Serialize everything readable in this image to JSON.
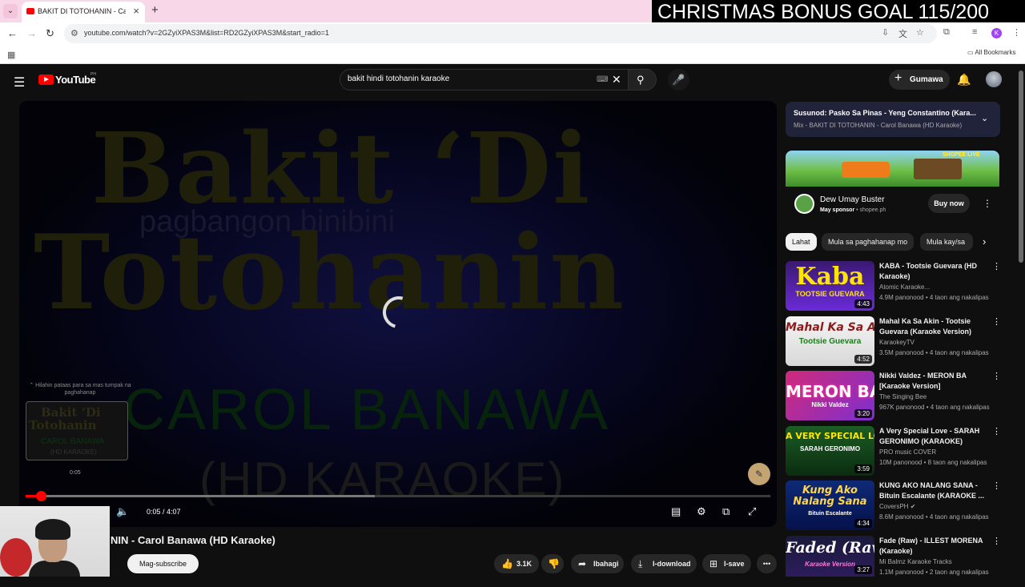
{
  "browser": {
    "tab_title": "BAKIT DI TOTOHANIN - Carol B",
    "url": "youtube.com/watch?v=2GZyiXPAS3M&list=RD2GZyiXPAS3M&start_radio=1",
    "all_bookmarks": "All Bookmarks",
    "profile_letter": "K"
  },
  "stream_banner": "CHRISTMAS BONUS GOAL 115/200",
  "youtube": {
    "logo_text": "YouTube",
    "country": "PH",
    "search_query": "bakit hindi totohanin karaoke",
    "create_label": "Gumawa"
  },
  "player": {
    "bg_title_line1": "Bakit ‘Di",
    "bg_title_line2": "Totohanin",
    "bg_subtitle": "pagbangon binibini",
    "bg_artist": "CAROL BANAWA",
    "bg_hd": "(HD KARAOKE)",
    "preview_hint": "Hilahin pataas para sa mas tumpak na paghahanap",
    "preview_time": "0:05",
    "preview_t1": "Bakit ‘Di",
    "preview_t2": "Totohanin",
    "preview_t3": "CAROL BANAWA",
    "preview_t4": "(HD KARAOKE)",
    "time_display": "0:05 / 4:07",
    "progress_fraction": 0.02
  },
  "video": {
    "title": "NIN - Carol Banawa (HD Karaoke)",
    "subscribe_label": "Mag-subscribe",
    "likes": "3.1K",
    "share_label": "Ibahagi",
    "download_label": "I-download",
    "save_label": "I-save"
  },
  "up_next": {
    "line1": "Susunod: Pasko Sa Pinas - Yeng Constantino (Kara...",
    "line2": "Mix - BAKIT DI TOTOHANIN - Carol Banawa (HD Karaoke)"
  },
  "ad": {
    "banner_tag": "SHOPEE LIVE",
    "title": "Dew Umay Buster",
    "sponsor_label": "May sponsor",
    "sponsor_site": "shopee.ph",
    "buy_label": "Buy now"
  },
  "chips": [
    "Lahat",
    "Mula sa paghahanap mo",
    "Mula kay/sa"
  ],
  "recommendations": [
    {
      "title": "KABA - Tootsie Guevara (HD Karaoke)",
      "channel": "Atomic Karaoke...",
      "meta": "4.9M panonood • 4 taon ang nakalipas",
      "duration": "4:43",
      "thumb_big": "Kaba",
      "thumb_small": "TOOTSIE GUEVARA"
    },
    {
      "title": "Mahal Ka Sa Akin - Tootsie Guevara (Karaoke Version)",
      "channel": "KaraokeyTV",
      "meta": "3.5M panonood • 4 taon ang nakalipas",
      "duration": "4:52",
      "thumb_big": "Mahal Ka Sa Akin",
      "thumb_small": "Tootsie Guevara"
    },
    {
      "title": "Nikki Valdez - MERON BA [Karaoke Version]",
      "channel": "The Singing Bee",
      "meta": "967K panonood • 4 taon ang nakalipas",
      "duration": "3:20",
      "thumb_big": "MERON BA",
      "thumb_small": "Nikki Valdez"
    },
    {
      "title": "A Very Special Love - SARAH GERONIMO (KARAOKE)",
      "channel": "PRO music COVER",
      "meta": "10M panonood • 8 taon ang nakalipas",
      "duration": "3:59",
      "thumb_big": "A VERY SPECIAL LOVE",
      "thumb_small": "SARAH GERONIMO"
    },
    {
      "title": "KUNG AKO NALANG SANA - Bituin Escalante (KARAOKE ...",
      "channel": "CoversPH",
      "meta": "8.6M panonood • 4 taon ang nakalipas",
      "duration": "4:34",
      "thumb_big": "Kung Ako Nalang Sana",
      "thumb_small": "Bituin Escalante"
    },
    {
      "title": "Fade (Raw) - ILLEST MORENA (Karaoke)",
      "channel": "Mi Balmz Karaoke Tracks",
      "meta": "1.1M panonood • 2 taon ang nakalipas",
      "duration": "3:27",
      "thumb_big": "Faded (Raw)",
      "thumb_small": "Karaoke Version"
    }
  ],
  "colors": {
    "accent_red": "#ff0000",
    "upnext_bg": "#20233a"
  }
}
